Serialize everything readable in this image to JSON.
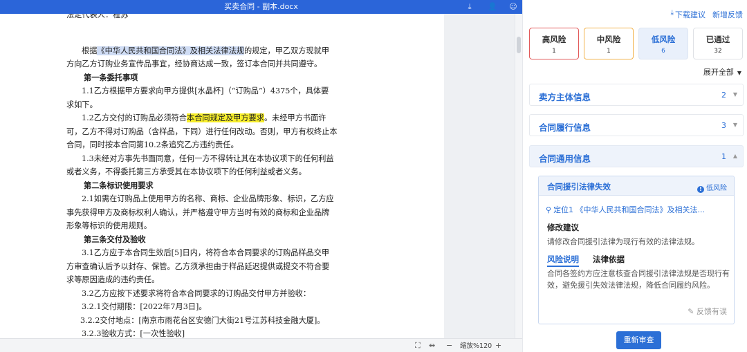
{
  "document": {
    "title": "买卖合同 - 副本.docx",
    "lines": [
      {
        "cls": "",
        "text": "法定代表人：程苏"
      },
      {
        "cls": "gap",
        "text": ""
      },
      {
        "cls": "ind1",
        "pre": "根据",
        "hl": "《中华人民共和国合同法》及相关法律法规",
        "hlcolor": "blue",
        "post": "的规定，甲乙双方现就甲"
      },
      {
        "cls": "",
        "text": "方向乙方订购业务宣传品事宜，经协商达成一致，签订本合同并共同遵守。"
      },
      {
        "cls": "head",
        "text": "第一条委托事项"
      },
      {
        "cls": "ind2",
        "text": "1.1乙方根据甲方要求向甲方提供[水晶杯]（“订购品”）4375个，具体要"
      },
      {
        "cls": "",
        "text": "求如下。"
      },
      {
        "cls": "ind2",
        "pre": "1.2乙方交付的订购品必须符合",
        "hl": "本合同规定及甲方要求",
        "hlcolor": "yellow",
        "post": "。未经甲方书面许"
      },
      {
        "cls": "",
        "text": "可，乙方不得对订购品（含样品，下同）进行任何改动。否则，甲方有权终止本"
      },
      {
        "cls": "",
        "text": "合同，同时按本合同第10.2条追究乙方违约责任。"
      },
      {
        "cls": "ind2",
        "text": "1.3未经对方事先书面同意，任何一方不得转让其在本协议项下的任何利益"
      },
      {
        "cls": "",
        "text": "或者义务，不得委托第三方承受其在本协议项下的任何利益或者义务。"
      },
      {
        "cls": "head",
        "text": "第二条标识使用要求"
      },
      {
        "cls": "ind2",
        "text": "2.1如需在订购品上使用甲方的名称、商标、企业品牌形象、标识，乙方应"
      },
      {
        "cls": "",
        "text": "事先获得甲方及商标权利人确认，并严格遵守甲方当时有效的商标和企业品牌"
      },
      {
        "cls": "",
        "text": "形象等标识的使用规则。"
      },
      {
        "cls": "head",
        "text": "第三条交付及验收"
      },
      {
        "cls": "ind2",
        "text": "3.1乙方应于本合同生效后[5]日内，将符合本合同要求的订购品样品交甲"
      },
      {
        "cls": "",
        "text": "方审查确认后予以封存、保管。乙方须承担由于样品延迟提供或提交不符合要"
      },
      {
        "cls": "",
        "text": "求等原因造成的违约责任。"
      },
      {
        "cls": "ind2",
        "text": "3.2乙方应按下述要求将符合本合同要求的订购品交付甲方并验收："
      },
      {
        "cls": "ind2",
        "text": "3.2.1交付期限：[2022年7月3日]。"
      },
      {
        "cls": "ind3",
        "text": "3.2.2交付地点：[南京市雨花台区安德门大街21号江苏科技金融大厦]。"
      },
      {
        "cls": "ind2",
        "text": "3.2.3验收方式：[一次性验收]"
      }
    ]
  },
  "statusbar": {
    "zoom_label": "缩放%120",
    "minus": "−",
    "plus": "+"
  },
  "panel": {
    "download_label": "下载建议",
    "add_feedback_label": "新增反馈",
    "risk_cards": [
      {
        "label": "高风险",
        "count": "1"
      },
      {
        "label": "中风险",
        "count": "1"
      },
      {
        "label": "低风险",
        "count": "6"
      },
      {
        "label": "已通过",
        "count": "32"
      }
    ],
    "expand_all": "展开全部",
    "sections": [
      {
        "title": "卖方主体信息",
        "count": "2"
      },
      {
        "title": "合同履行信息",
        "count": "3"
      },
      {
        "title": "合同通用信息",
        "count": "1"
      }
    ],
    "issue": {
      "title": "合同援引法律失效",
      "badge": "低风险",
      "location": "定位1 《中华人民共和国合同法》及相关法...",
      "suggestion_title": "修改建议",
      "suggestion_text": "请修改合同援引法律为现行有效的法律法规。",
      "tab_explain": "风险说明",
      "tab_basis": "法律依据",
      "explanation": "合同各签约方应注意核查合同援引法律法规是否现行有效，避免援引失效法律法规，降低合同履约风险。",
      "feedback": "反馈有误"
    },
    "rescan_label": "重新审查"
  },
  "colors": {
    "accent": "#2b6fd6",
    "titlebar": "#2b65d9",
    "high_risk": "#e25959",
    "mid_risk": "#f2b24a",
    "highlight_yellow": "#f7ee2a",
    "highlight_blue": "#cfdcf4"
  },
  "icons": {
    "titlebar": [
      "download-icon",
      "user-add-icon",
      "smile-icon"
    ],
    "statusbar": [
      "fit-page-icon",
      "fit-width-icon"
    ],
    "panel": [
      "download-icon",
      "location-pin-icon",
      "info-icon",
      "edit-icon",
      "chevron-down-icon",
      "chevron-up-icon"
    ]
  }
}
